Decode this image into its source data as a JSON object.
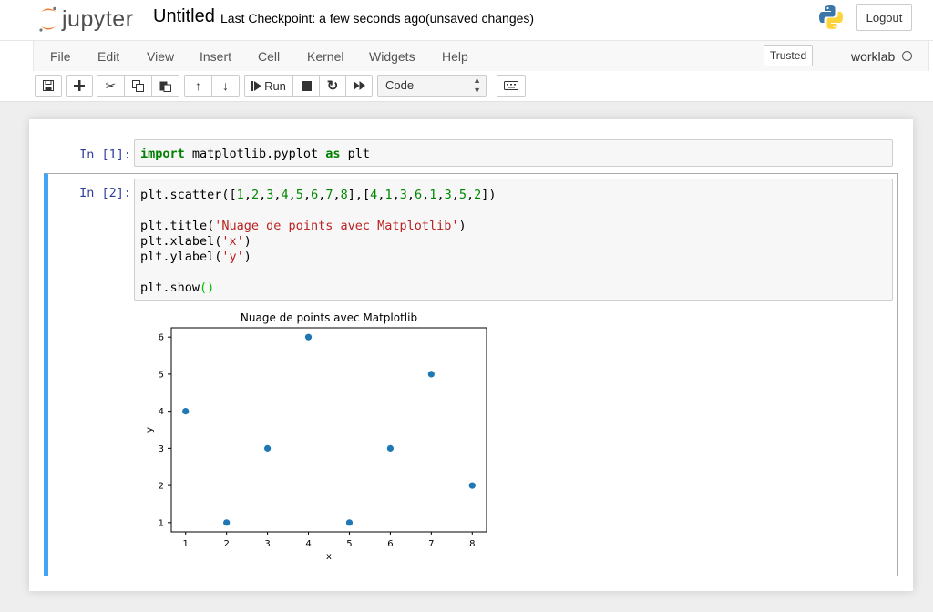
{
  "header": {
    "logo_text": "jupyter",
    "notebook_name": "Untitled",
    "checkpoint": "Last Checkpoint: a few seconds ago",
    "autosave_status": "(unsaved changes)",
    "logout_label": "Logout"
  },
  "menubar": {
    "items": [
      "File",
      "Edit",
      "View",
      "Insert",
      "Cell",
      "Kernel",
      "Widgets",
      "Help"
    ],
    "trusted_label": "Trusted",
    "kernel_name": "worklab"
  },
  "toolbar": {
    "buttons": [
      "save-icon",
      "plus-icon",
      "scissors-icon",
      "copy-icon",
      "paste-icon",
      "arrow-up-icon",
      "arrow-down-icon",
      "step-forward-icon",
      "stop-icon",
      "refresh-icon",
      "fast-forward-icon",
      "keyboard-icon"
    ],
    "run_label": "Run",
    "cell_type": "Code"
  },
  "cells": [
    {
      "prompt": "In [1]:",
      "code_lines": [
        "import matplotlib.pyplot as plt"
      ]
    },
    {
      "prompt": "In [2]:",
      "code_lines": [
        "plt.scatter([1,2,3,4,5,6,7,8],[4,1,3,6,1,3,5,2])",
        "",
        "plt.title('Nuage de points avec Matplotlib')",
        "plt.xlabel('x')",
        "plt.ylabel('y')",
        "",
        "plt.show()"
      ]
    }
  ],
  "chart_data": {
    "type": "scatter",
    "title": "Nuage de points avec Matplotlib",
    "xlabel": "x",
    "ylabel": "y",
    "x": [
      1,
      2,
      3,
      4,
      5,
      6,
      7,
      8
    ],
    "y": [
      4,
      1,
      3,
      6,
      1,
      3,
      5,
      2
    ],
    "xticks": [
      "1",
      "2",
      "3",
      "4",
      "5",
      "6",
      "7",
      "8"
    ],
    "yticks": [
      "1",
      "2",
      "3",
      "4",
      "5",
      "6"
    ],
    "xlim": [
      0.65,
      8.35
    ],
    "ylim": [
      0.75,
      6.25
    ],
    "grid": false,
    "color": "#1f77b4"
  }
}
